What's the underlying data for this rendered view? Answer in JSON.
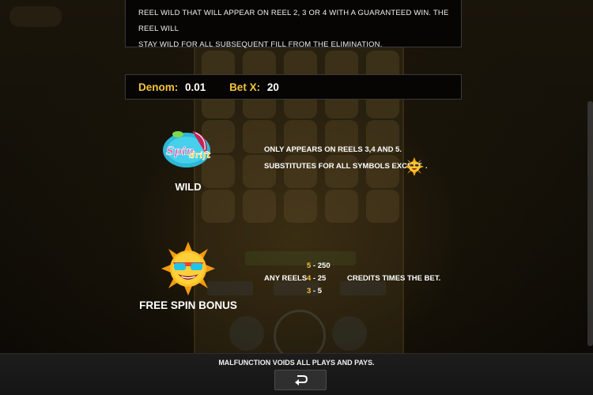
{
  "rules": {
    "description_lines": [
      "REEL WILD THAT WILL APPEAR ON REEL 2, 3 OR 4 WITH A GUARANTEED WIN. THE REEL WILL",
      "STAY WILD FOR ALL SUBSEQUENT FILL FROM THE ELIMINATION."
    ]
  },
  "bet": {
    "denom_label": "Denom:",
    "denom_value": "0.01",
    "betx_label": "Bet X:",
    "betx_value": "20"
  },
  "wild": {
    "logo_text": "Spindrift",
    "label": "WILD",
    "line1": "ONLY APPEARS ON REELS 3,4 AND 5.",
    "line2": "SUBSTITUTES FOR ALL SYMBOLS EXCEPT",
    "line2_suffix": "."
  },
  "free_spin": {
    "label": "FREE SPIN BONUS",
    "any_reels": "ANY REELS",
    "credits_text": "CREDITS TIMES THE BET.",
    "pays": [
      {
        "count": "5",
        "sep": " - ",
        "value": "250"
      },
      {
        "count": "4",
        "sep": " - ",
        "value": "25"
      },
      {
        "count": "3",
        "sep": " - ",
        "value": "5"
      }
    ]
  },
  "footer": {
    "notice": "MALFUNCTION VOIDS ALL PLAYS AND PAYS.",
    "back_icon": "return-arrow-icon"
  },
  "colors": {
    "accent_gold": "#f3c53a",
    "panel_bg": "#060504",
    "footer_bg": "#1d1d1d"
  }
}
